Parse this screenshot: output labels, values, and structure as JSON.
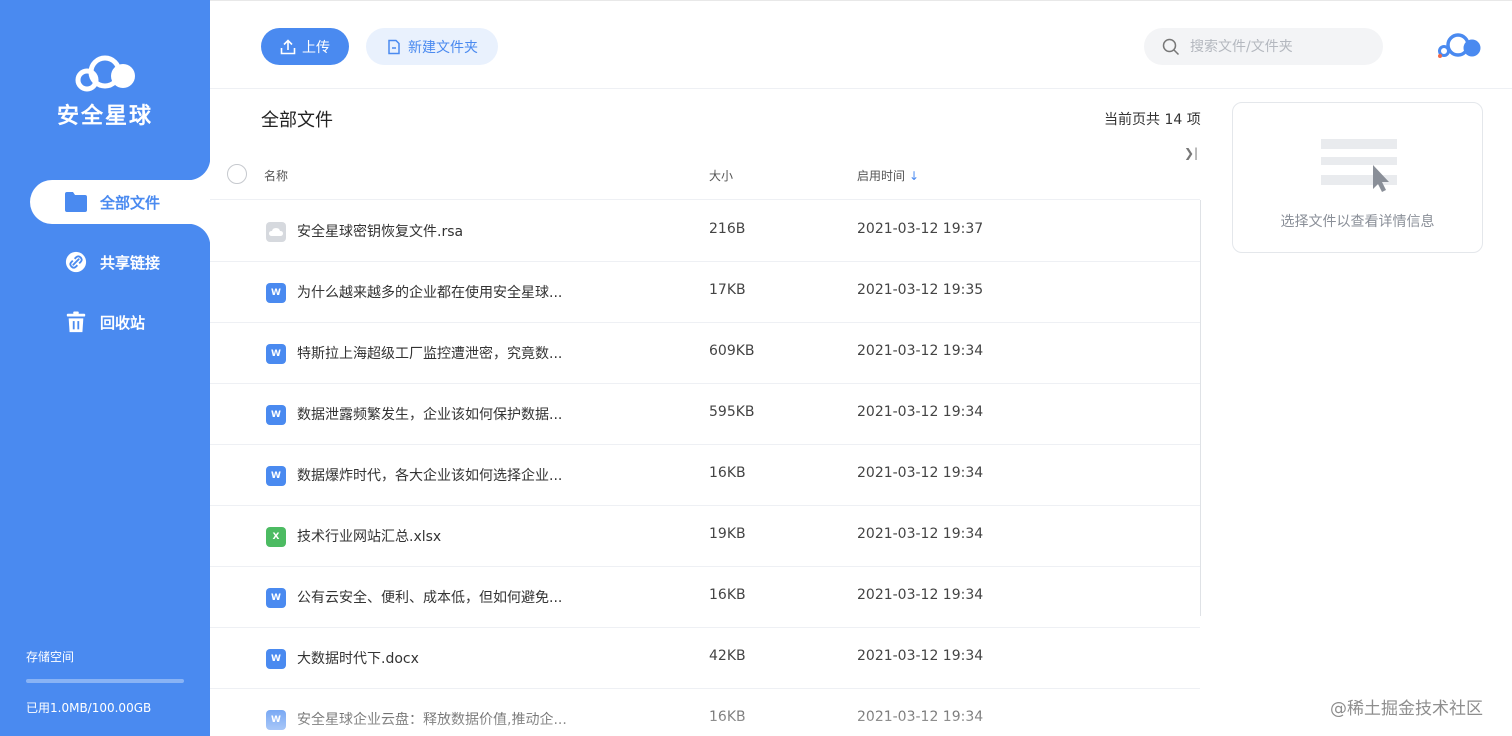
{
  "app": {
    "name": "安全星球",
    "brand_color": "#4a8af0"
  },
  "sidebar": {
    "items": [
      {
        "label": "全部文件",
        "icon": "folder-icon",
        "active": true
      },
      {
        "label": "共享链接",
        "icon": "link-icon",
        "active": false
      },
      {
        "label": "回收站",
        "icon": "trash-icon",
        "active": false
      }
    ],
    "storage": {
      "title": "存储空间",
      "used_text": "已用1.0MB/100.00GB",
      "used_fraction": 1e-05
    }
  },
  "toolbar": {
    "upload_label": "上传",
    "new_folder_label": "新建文件夹",
    "search_placeholder": "搜索文件/文件夹"
  },
  "main": {
    "title": "全部文件",
    "count_text": "当前页共 14 项",
    "columns": {
      "name": "名称",
      "size": "大小",
      "time": "启用时间"
    },
    "files": [
      {
        "name": "安全星球密钥恢复文件.rsa",
        "size": "216B",
        "time": "2021-03-12 19:37",
        "type": "rsa"
      },
      {
        "name": "为什么越来越多的企业都在使用安全星球...",
        "size": "17KB",
        "time": "2021-03-12 19:35",
        "type": "word"
      },
      {
        "name": "特斯拉上海超级工厂监控遭泄密，究竟数...",
        "size": "609KB",
        "time": "2021-03-12 19:34",
        "type": "word"
      },
      {
        "name": "数据泄露频繁发生，企业该如何保护数据...",
        "size": "595KB",
        "time": "2021-03-12 19:34",
        "type": "word"
      },
      {
        "name": "数据爆炸时代，各大企业该如何选择企业...",
        "size": "16KB",
        "time": "2021-03-12 19:34",
        "type": "word"
      },
      {
        "name": "技术行业网站汇总.xlsx",
        "size": "19KB",
        "time": "2021-03-12 19:34",
        "type": "excel"
      },
      {
        "name": "公有云安全、便利、成本低，但如何避免...",
        "size": "16KB",
        "time": "2021-03-12 19:34",
        "type": "word"
      },
      {
        "name": "大数据时代下.docx",
        "size": "42KB",
        "time": "2021-03-12 19:34",
        "type": "word"
      },
      {
        "name": "安全星球企业云盘：释放数据价值,推动企...",
        "size": "16KB",
        "time": "2021-03-12 19:34",
        "type": "word"
      }
    ]
  },
  "detail": {
    "empty_text": "选择文件以查看详情信息"
  },
  "watermark": "@稀土掘金技术社区",
  "icon_letters": {
    "word": "W",
    "excel": "X"
  }
}
